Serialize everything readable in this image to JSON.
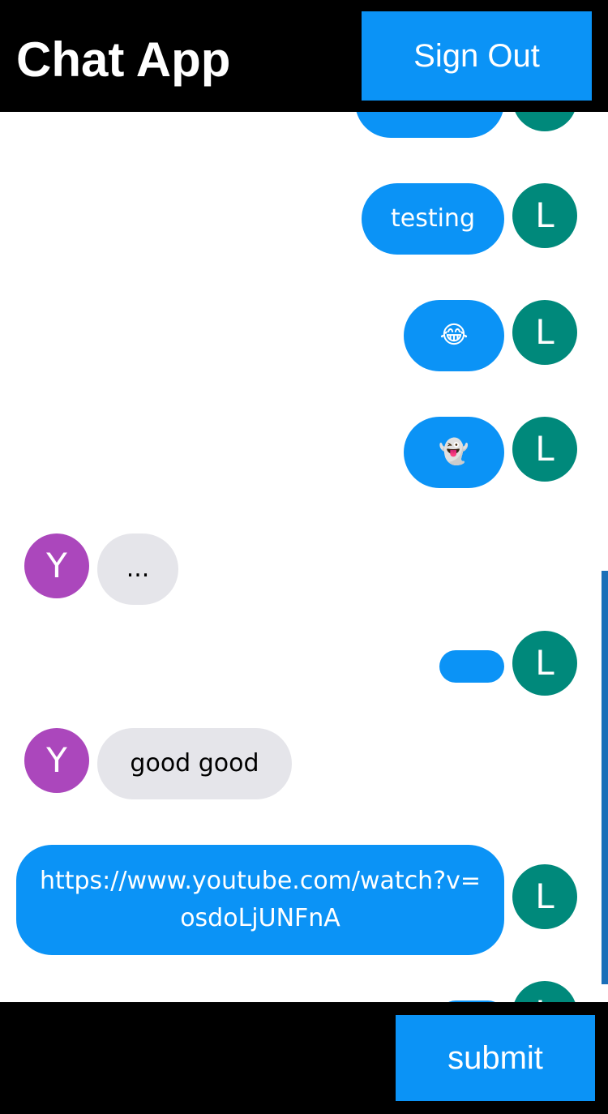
{
  "header": {
    "title": "Chat App",
    "signout_label": "Sign Out"
  },
  "messages": [
    {
      "type": "sent",
      "text": "",
      "avatar": "L"
    },
    {
      "type": "sent",
      "text": "testing",
      "avatar": "L"
    },
    {
      "type": "sent",
      "text": "😂",
      "avatar": "L"
    },
    {
      "type": "sent",
      "text": "👻",
      "avatar": "L"
    },
    {
      "type": "received",
      "text": "...",
      "avatar": "Y"
    },
    {
      "type": "sent",
      "text": "",
      "avatar": "L"
    },
    {
      "type": "received",
      "text": "good good",
      "avatar": "Y"
    },
    {
      "type": "sent",
      "text": "https://www.youtube.com/watch?v=osdoLjUNFnA",
      "text_line1": "https://www.youtube.com/watch?v=",
      "text_line2": "osdoLjUNFnA",
      "avatar": "L"
    },
    {
      "type": "sent",
      "text": "",
      "avatar": "L"
    }
  ],
  "footer": {
    "input_value": "",
    "input_placeholder": "",
    "submit_label": "submit"
  },
  "colors": {
    "sent_bubble": "#0b93f6",
    "received_bubble": "#e5e5ea",
    "sent_avatar": "#00897b",
    "received_avatar": "#ab47bc",
    "header_bg": "#000000",
    "button_bg": "#0b93f6"
  }
}
